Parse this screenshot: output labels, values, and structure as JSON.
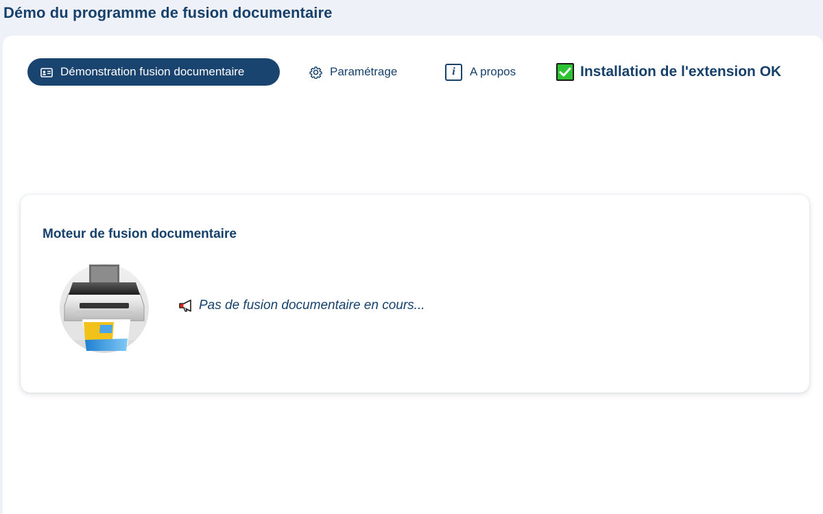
{
  "header": {
    "title": "Démo du programme de fusion documentaire"
  },
  "nav": {
    "tabs": [
      {
        "label": "Démonstration fusion documentaire",
        "icon": "id-card-icon",
        "active": true
      },
      {
        "label": "Paramétrage",
        "icon": "gear-icon",
        "active": false
      },
      {
        "label": "A propos",
        "icon": "info-icon",
        "active": false
      }
    ],
    "status": {
      "label": "Installation de l'extension OK",
      "icon": "checkmark-icon",
      "color": "#2ec335"
    }
  },
  "card": {
    "title": "Moteur de fusion documentaire",
    "image_icon": "printer-icon",
    "message_icon": "megaphone-icon",
    "message": "Pas de fusion documentaire en cours..."
  },
  "colors": {
    "primary": "#1a4470",
    "text": "#17416b",
    "background": "#eef2f8",
    "success": "#2ec335"
  }
}
